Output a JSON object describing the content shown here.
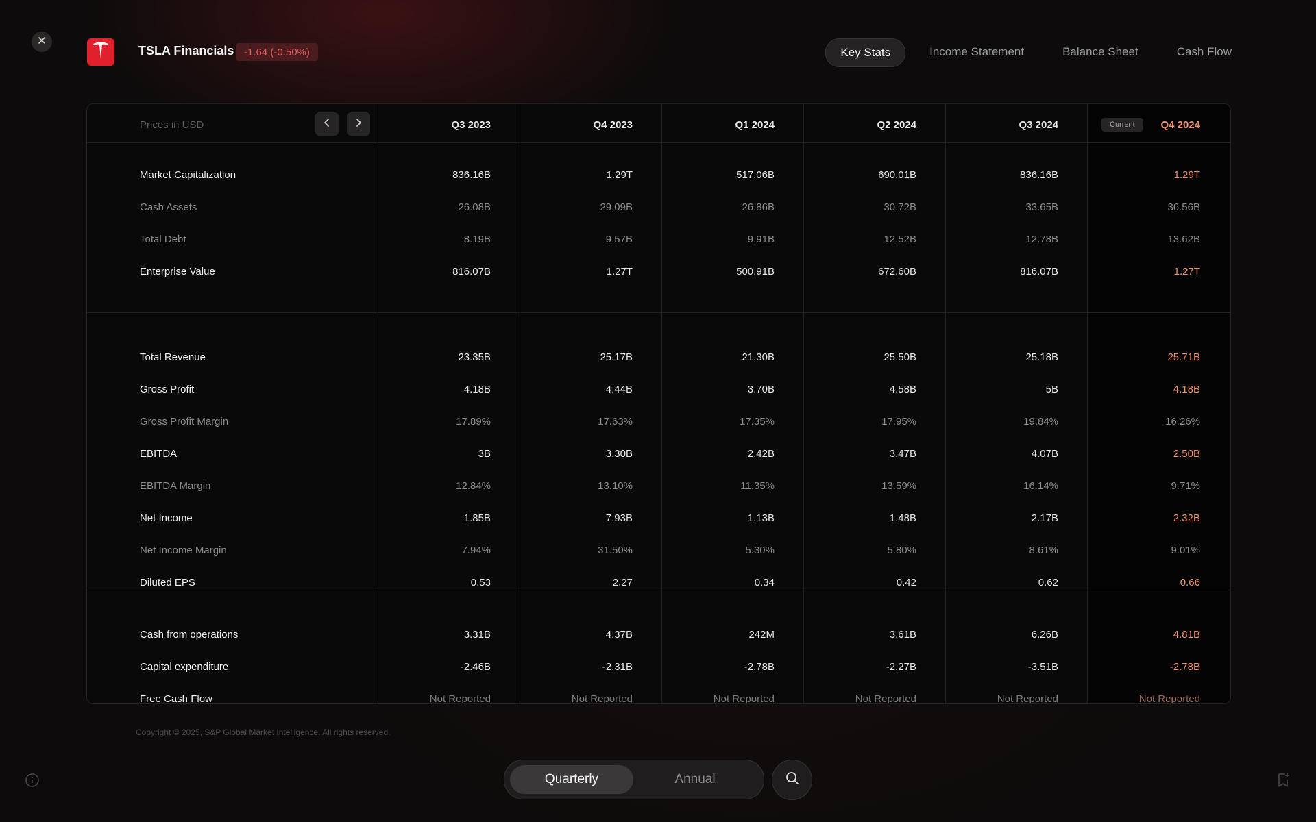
{
  "header": {
    "ticker_title": "TSLA Financials",
    "change": "-1.64 (-0.50%)",
    "change_color": "#e25d5d",
    "logo_icon": "tesla-logo-icon",
    "close_icon": "close-icon"
  },
  "tabs": [
    {
      "label": "Key Stats",
      "active": true
    },
    {
      "label": "Income Statement",
      "active": false
    },
    {
      "label": "Balance Sheet",
      "active": false
    },
    {
      "label": "Cash Flow",
      "active": false
    }
  ],
  "table": {
    "prices_label": "Prices in USD",
    "current_badge": "Current",
    "columns": [
      "Q3 2023",
      "Q4 2023",
      "Q1 2024",
      "Q2 2024",
      "Q3 2024",
      "Q4 2024"
    ],
    "current_color": "#f0916b",
    "sections": [
      {
        "rows": [
          {
            "label": "Market Capitalization",
            "muted": false,
            "values": [
              "836.16B",
              "1.29T",
              "517.06B",
              "690.01B",
              "836.16B",
              "1.29T"
            ]
          },
          {
            "label": "Cash Assets",
            "muted": true,
            "values": [
              "26.08B",
              "29.09B",
              "26.86B",
              "30.72B",
              "33.65B",
              "36.56B"
            ]
          },
          {
            "label": "Total Debt",
            "muted": true,
            "values": [
              "8.19B",
              "9.57B",
              "9.91B",
              "12.52B",
              "12.78B",
              "13.62B"
            ]
          },
          {
            "label": "Enterprise Value",
            "muted": false,
            "values": [
              "816.07B",
              "1.27T",
              "500.91B",
              "672.60B",
              "816.07B",
              "1.27T"
            ]
          }
        ]
      },
      {
        "rows": [
          {
            "label": "Total Revenue",
            "muted": false,
            "values": [
              "23.35B",
              "25.17B",
              "21.30B",
              "25.50B",
              "25.18B",
              "25.71B"
            ]
          },
          {
            "label": "Gross Profit",
            "muted": false,
            "values": [
              "4.18B",
              "4.44B",
              "3.70B",
              "4.58B",
              "5B",
              "4.18B"
            ]
          },
          {
            "label": "Gross Profit Margin",
            "muted": true,
            "values": [
              "17.89%",
              "17.63%",
              "17.35%",
              "17.95%",
              "19.84%",
              "16.26%"
            ]
          },
          {
            "label": "EBITDA",
            "muted": false,
            "values": [
              "3B",
              "3.30B",
              "2.42B",
              "3.47B",
              "4.07B",
              "2.50B"
            ]
          },
          {
            "label": "EBITDA Margin",
            "muted": true,
            "values": [
              "12.84%",
              "13.10%",
              "11.35%",
              "13.59%",
              "16.14%",
              "9.71%"
            ]
          },
          {
            "label": "Net Income",
            "muted": false,
            "values": [
              "1.85B",
              "7.93B",
              "1.13B",
              "1.48B",
              "2.17B",
              "2.32B"
            ]
          },
          {
            "label": "Net Income Margin",
            "muted": true,
            "values": [
              "7.94%",
              "31.50%",
              "5.30%",
              "5.80%",
              "8.61%",
              "9.01%"
            ]
          },
          {
            "label": "Diluted EPS",
            "muted": false,
            "values": [
              "0.53",
              "2.27",
              "0.34",
              "0.42",
              "0.62",
              "0.66"
            ]
          }
        ]
      },
      {
        "rows": [
          {
            "label": "Cash from operations",
            "muted": false,
            "values": [
              "3.31B",
              "4.37B",
              "242M",
              "3.61B",
              "6.26B",
              "4.81B"
            ]
          },
          {
            "label": "Capital expenditure",
            "muted": false,
            "values": [
              "-2.46B",
              "-2.31B",
              "-2.78B",
              "-2.27B",
              "-3.51B",
              "-2.78B"
            ]
          },
          {
            "label": "Free Cash Flow",
            "muted": false,
            "dim": true,
            "values": [
              "Not Reported",
              "Not Reported",
              "Not Reported",
              "Not Reported",
              "Not Reported",
              "Not Reported"
            ]
          }
        ]
      }
    ]
  },
  "footer": {
    "copyright": "Copyright © 2025, S&P Global Market Intelligence. All rights reserved.",
    "period_options": [
      {
        "label": "Quarterly",
        "active": true
      },
      {
        "label": "Annual",
        "active": false
      }
    ]
  }
}
